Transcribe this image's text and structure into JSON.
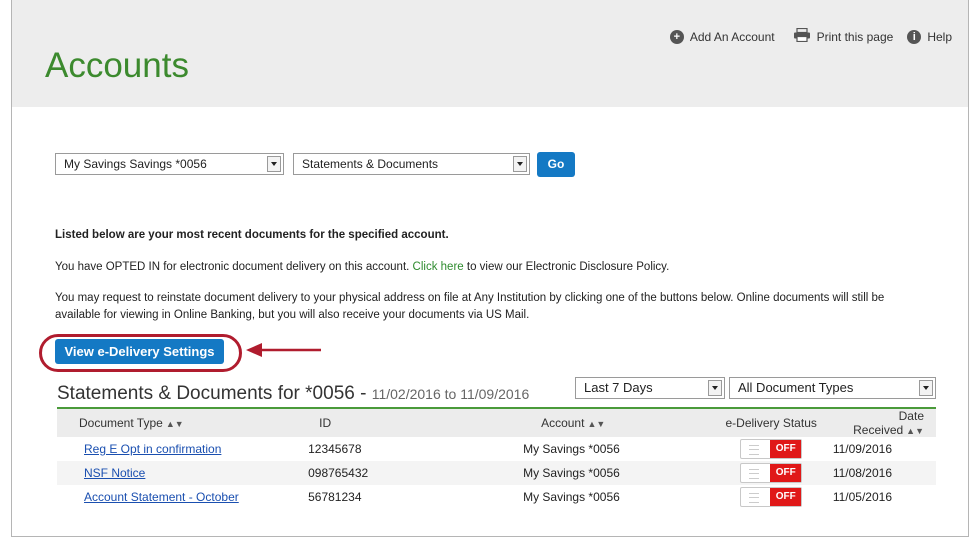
{
  "header": {
    "title": "Accounts",
    "links": [
      {
        "label": "Add An Account",
        "icon": "plus-circle-icon"
      },
      {
        "label": "Print this page",
        "icon": "printer-icon"
      },
      {
        "label": "Help",
        "icon": "info-icon"
      }
    ]
  },
  "filters": {
    "account": "My Savings Savings *0056",
    "doc_category": "Statements & Documents",
    "go_label": "Go"
  },
  "text": {
    "intro": "Listed below are your most recent documents for the specified account.",
    "opted_prefix": "You have OPTED IN for electronic document delivery on this account.  ",
    "click_here": "Click here",
    "opted_suffix": " to view our Electronic Disclosure Policy.",
    "reinstate_line1": "You may request to reinstate document delivery to your physical address on file at Any Institution by clicking one of the buttons below. Online documents will still be",
    "reinstate_line2": "available for viewing in Online Banking, but you will also receive your documents via US Mail."
  },
  "button": {
    "label": "View e-Delivery Settings"
  },
  "section": {
    "title": "Statements & Documents for *0056 - ",
    "range": "11/02/2016 to 11/09/2016",
    "period": "Last 7 Days",
    "doc_types": "All Document Types"
  },
  "table": {
    "headers": [
      "Document Type",
      "ID",
      "Account",
      "e-Delivery Status",
      "Date Received"
    ],
    "rows": [
      {
        "type": "Reg E Opt in confirmation",
        "id": "12345678",
        "account": "My Savings *0056",
        "status": "OFF",
        "date": "11/09/2016"
      },
      {
        "type": "NSF Notice",
        "id": "098765432",
        "account": "My Savings *0056",
        "status": "OFF",
        "date": "11/08/2016"
      },
      {
        "type": "Account Statement - October",
        "id": "56781234",
        "account": "My Savings *0056",
        "status": "OFF",
        "date": "11/05/2016"
      }
    ]
  },
  "colors": {
    "accent": "#1479c4",
    "title_green": "#3c8a2e",
    "highlight_red": "#b01c2e",
    "toggle_off": "#e01818"
  }
}
